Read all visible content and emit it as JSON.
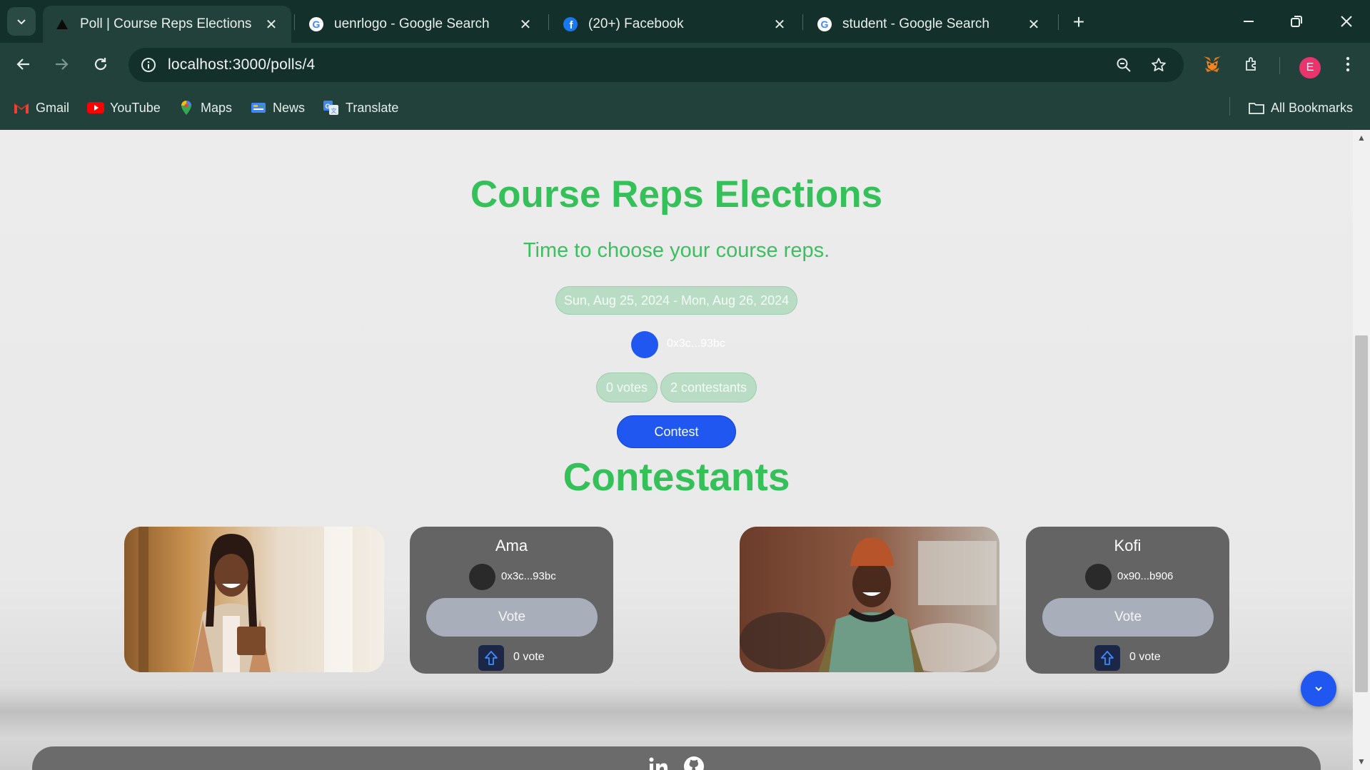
{
  "browser": {
    "tabs": [
      {
        "title": "Poll | Course Reps Elections",
        "favicon": "triangle-logo-icon",
        "active": true
      },
      {
        "title": "uenrlogo - Google Search",
        "favicon": "google-icon",
        "active": false
      },
      {
        "title": "(20+) Facebook",
        "favicon": "facebook-icon",
        "active": false
      },
      {
        "title": "student - Google Search",
        "favicon": "google-icon",
        "active": false
      }
    ],
    "url": "localhost:3000/polls/4",
    "profile_initial": "E",
    "bookmarks": [
      {
        "label": "Gmail",
        "icon": "gmail-icon"
      },
      {
        "label": "YouTube",
        "icon": "youtube-icon"
      },
      {
        "label": "Maps",
        "icon": "maps-icon"
      },
      {
        "label": "News",
        "icon": "news-icon"
      },
      {
        "label": "Translate",
        "icon": "translate-icon"
      }
    ],
    "all_bookmarks_label": "All Bookmarks"
  },
  "poll": {
    "title": "Course Reps Elections",
    "description": "Time to choose your course reps.",
    "date_range": "Sun, Aug 25, 2024 - Mon, Aug 26, 2024",
    "owner_address": "0x3c...93bc",
    "votes_label": "0 votes",
    "contestants_label": "2 contestants",
    "contest_label": "Contest"
  },
  "contestants_heading": "Contestants",
  "contestants": [
    {
      "name": "Ama",
      "address": "0x3c...93bc",
      "vote_label": "Vote",
      "count_label": "0 vote"
    },
    {
      "name": "Kofi",
      "address": "0x90...b906",
      "vote_label": "Vote",
      "count_label": "0 vote"
    }
  ],
  "colors": {
    "accent_green": "#36c05a",
    "primary_blue": "#1f57f0",
    "card_gray": "#646464",
    "pill_green": "#b8dcc4"
  }
}
